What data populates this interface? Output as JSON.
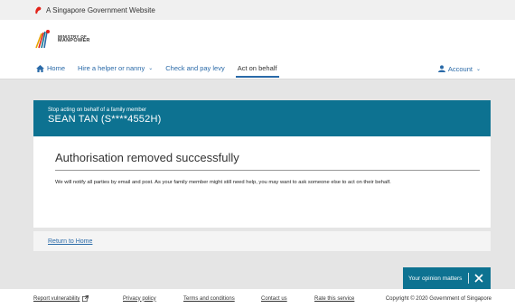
{
  "gov_bar": {
    "text": "A Singapore Government Website"
  },
  "logo": {
    "line1": "MINISTRY OF",
    "line2": "MANPOWER"
  },
  "nav": {
    "home": "Home",
    "hire": "Hire a helper or nanny",
    "levy": "Check and pay levy",
    "act": "Act on behalf",
    "account": "Account"
  },
  "banner": {
    "subtitle": "Stop acting on behalf of a family member",
    "name": "SEAN TAN (S****4552H)"
  },
  "card": {
    "title": "Authorisation removed successfully",
    "body": "We will notify all parties by email and post. As your family member might still need help, you may want to ask someone else to act on their behalf."
  },
  "return_link": "Return to Home",
  "opinion": {
    "label": "Your opinion matters"
  },
  "footer": {
    "report": "Report vulnerability",
    "privacy": "Privacy policy",
    "terms": "Terms and conditions",
    "contact": "Contact us",
    "rate": "Rate this service",
    "copyright": "Copyright © 2020 Government of Singapore"
  },
  "colors": {
    "accent": "#0d7291",
    "link": "#2a6aa8",
    "grey": "#e5e5e5"
  }
}
